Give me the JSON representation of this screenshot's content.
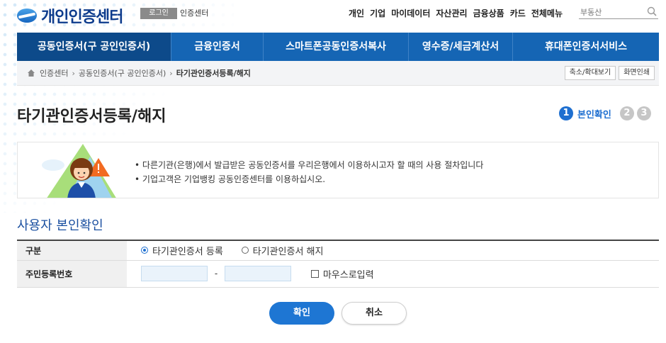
{
  "header": {
    "logo_text": "개인인증센터",
    "login_label": "로그인",
    "cert_center_label": "인증센터",
    "gnb": [
      "개인",
      "기업",
      "마이데이터",
      "자산관리",
      "금융상품",
      "카드",
      "전체메뉴"
    ],
    "search_placeholder": "부동산"
  },
  "nav": {
    "tabs": [
      {
        "label": "공동인증서(구 공인인증서)",
        "active": true
      },
      {
        "label": "금융인증서",
        "active": false
      },
      {
        "label": "스마트폰공동인증서복사",
        "active": false
      },
      {
        "label": "영수증/세금계산서",
        "active": false
      },
      {
        "label": "휴대폰인증서서비스",
        "active": false
      }
    ]
  },
  "breadcrumb": {
    "items": [
      "인증센터",
      "공동인증서(구 공인인증서)",
      "타기관인증서등록/해지"
    ],
    "zoom_label": "축소/확대보기",
    "print_label": "화면인쇄"
  },
  "page": {
    "title": "타기관인증서등록/해지",
    "steps": {
      "current_number": "1",
      "current_label": "본인확인",
      "others": [
        "2",
        "3"
      ]
    }
  },
  "info": {
    "lines": [
      "다른기관(은행)에서 발급받은 공동인증서를 우리은행에서 이용하시고자 할 때의 사용 절차입니다",
      "기업고객은 기업뱅킹 공동인증센터를 이용하십시오."
    ]
  },
  "form": {
    "section_title": "사용자 본인확인",
    "type_label": "구분",
    "type_options": [
      {
        "label": "타기관인증서 등록",
        "selected": true
      },
      {
        "label": "타기관인증서 해지",
        "selected": false
      }
    ],
    "ssn_label": "주민등록번호",
    "ssn_separator": "-",
    "ssn_front_value": "",
    "ssn_back_value": "",
    "mouse_input_label": "마우스로입력",
    "mouse_input_checked": false
  },
  "buttons": {
    "confirm": "확인",
    "cancel": "취소"
  },
  "colors": {
    "primary": "#1565b4",
    "active_tab": "#0d4a8a",
    "accent": "#1e76d3",
    "section_title": "#1a4fa0"
  }
}
